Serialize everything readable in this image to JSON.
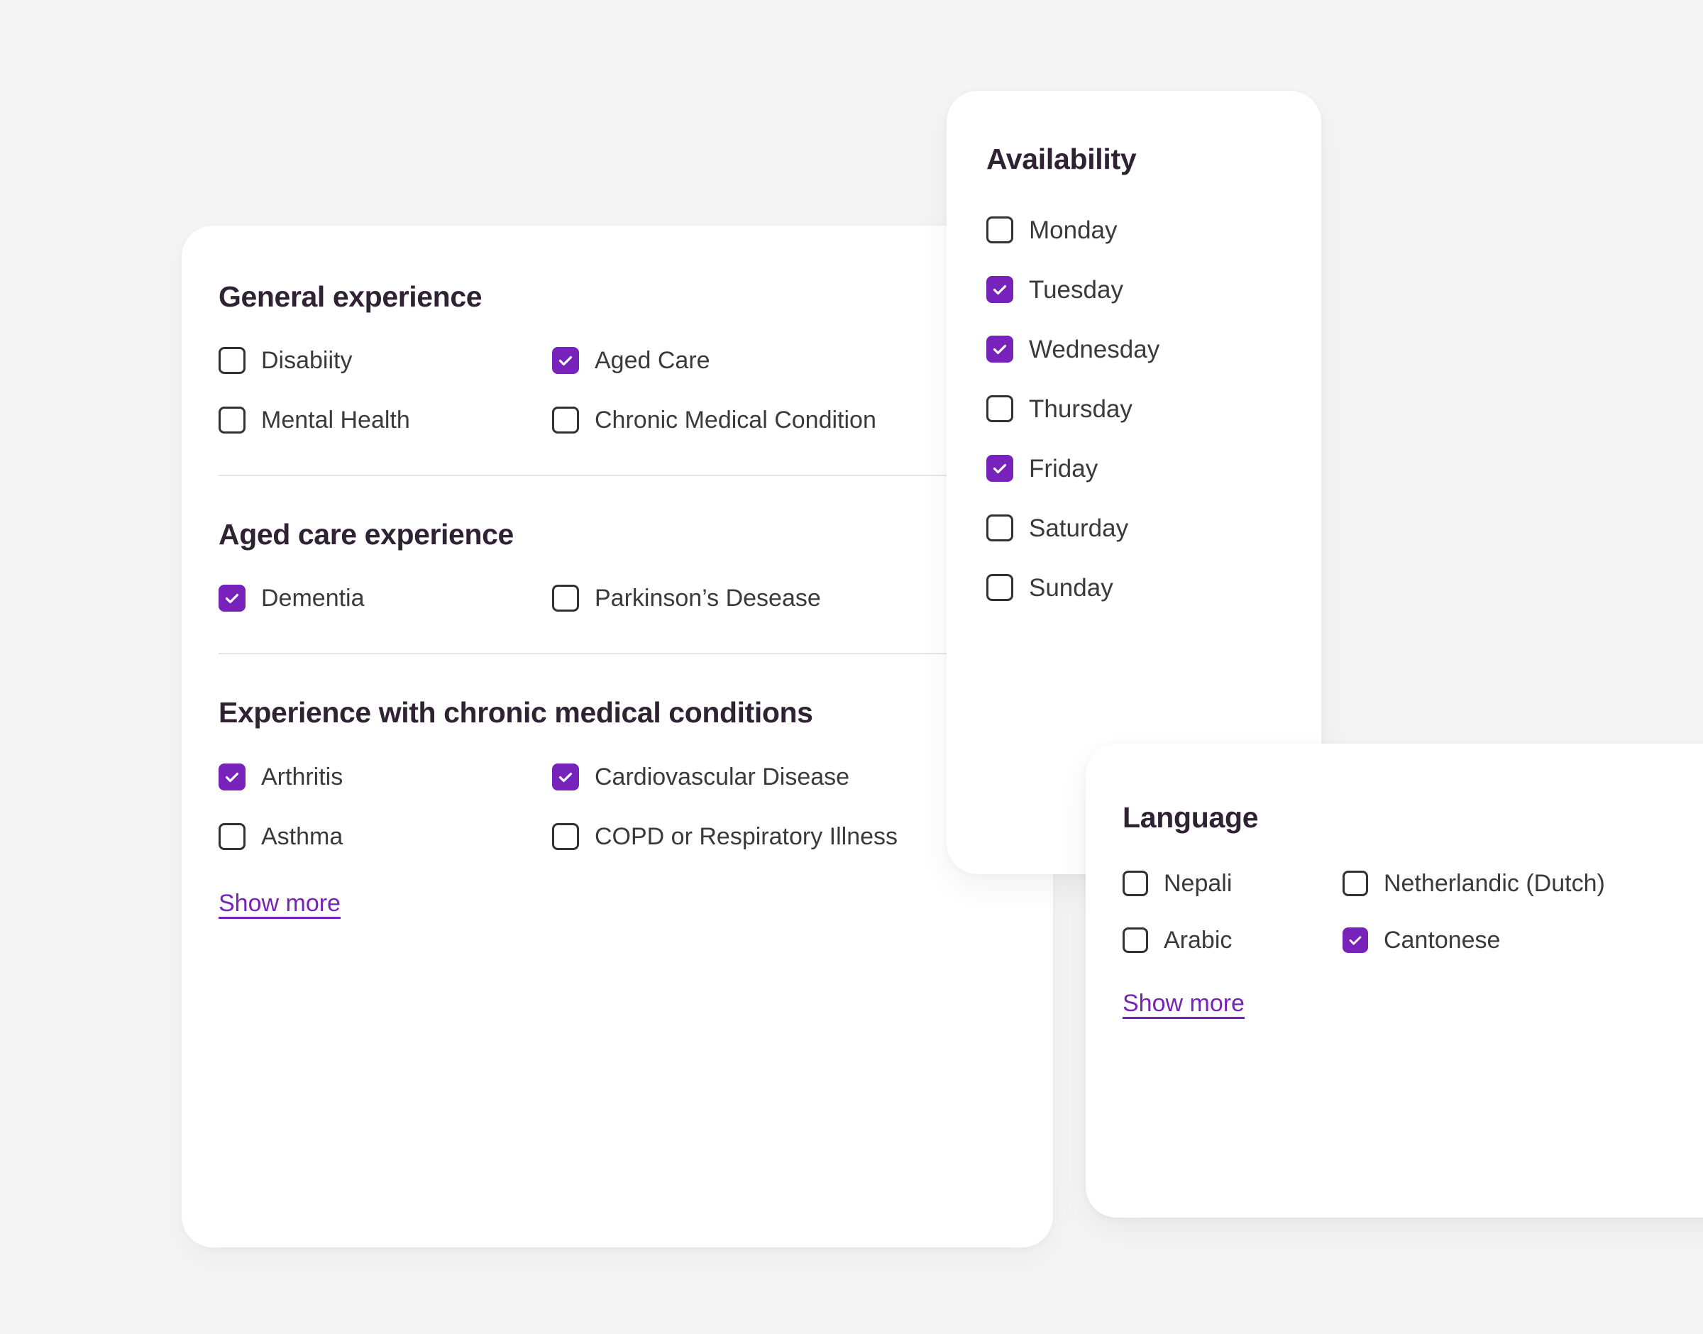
{
  "theme": {
    "background": "#f5f5f5",
    "card_background": "#ffffff",
    "accent_purple": "#7722bb",
    "heading_color": "#2e2233",
    "label_color": "#3a3a3a",
    "checkbox_border": "#333036",
    "divider_color": "#e6e4e4"
  },
  "experience_panel": {
    "sections": [
      {
        "title": "General experience",
        "items": [
          {
            "label": "Disabiity",
            "checked": false
          },
          {
            "label": "Aged Care",
            "checked": true
          },
          {
            "label": "Mental Health",
            "checked": false
          },
          {
            "label": "Chronic Medical Condition",
            "checked": false
          }
        ]
      },
      {
        "title": "Aged care experience",
        "items": [
          {
            "label": "Dementia",
            "checked": true
          },
          {
            "label": "Parkinson’s Desease",
            "checked": false
          }
        ]
      },
      {
        "title": "Experience with chronic medical conditions",
        "items": [
          {
            "label": "Arthritis",
            "checked": true
          },
          {
            "label": "Cardiovascular Disease",
            "checked": true
          },
          {
            "label": "Asthma",
            "checked": false
          },
          {
            "label": "COPD or Respiratory Illness",
            "checked": false
          }
        ],
        "show_more_label": "Show more"
      }
    ]
  },
  "availability_panel": {
    "title": "Availability",
    "items": [
      {
        "label": "Monday",
        "checked": false
      },
      {
        "label": "Tuesday",
        "checked": true
      },
      {
        "label": "Wednesday",
        "checked": true
      },
      {
        "label": "Thursday",
        "checked": false
      },
      {
        "label": "Friday",
        "checked": true
      },
      {
        "label": "Saturday",
        "checked": false
      },
      {
        "label": "Sunday",
        "checked": false
      }
    ]
  },
  "language_panel": {
    "title": "Language",
    "items": [
      {
        "label": "Nepali",
        "checked": false
      },
      {
        "label": "Netherlandic (Dutch)",
        "checked": false
      },
      {
        "label": "Arabic",
        "checked": false
      },
      {
        "label": "Cantonese",
        "checked": true
      }
    ],
    "show_more_label": "Show more"
  },
  "icons": {
    "checkmark": "check-icon",
    "checkbox_empty": "checkbox-unchecked-icon",
    "checkbox_checked": "checkbox-checked-icon"
  }
}
